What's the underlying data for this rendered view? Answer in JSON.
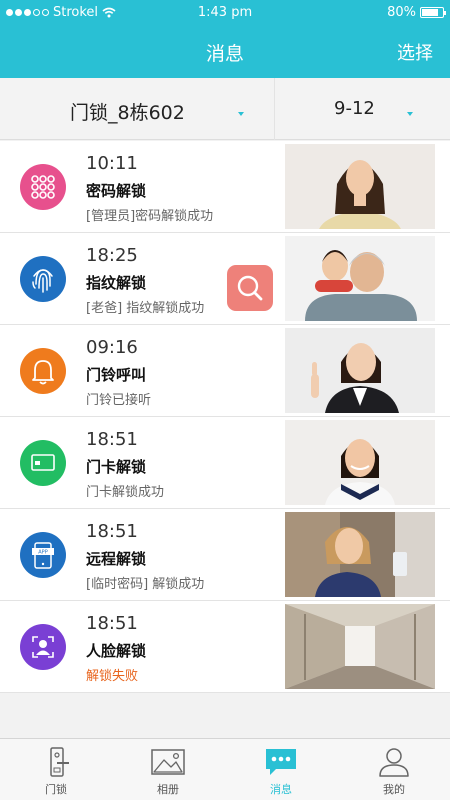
{
  "status_bar": {
    "carrier": "Strokel",
    "time": "1:43 pm",
    "battery": "80%",
    "battery_level": 0.8
  },
  "header": {
    "title": "消息",
    "action_label": "选择"
  },
  "filters": {
    "device": "门锁_8栋602",
    "date": "9-12"
  },
  "messages": [
    {
      "time": "10:11",
      "type": "密码解锁",
      "detail": "[管理员]密码解锁成功",
      "icon": "keypad-icon",
      "color": "#e7508d",
      "status": "success"
    },
    {
      "time": "18:25",
      "type": "指纹解锁",
      "detail": "[老爸] 指纹解锁成功",
      "icon": "fingerprint-icon",
      "color": "#1f70c1",
      "status": "success"
    },
    {
      "time": "09:16",
      "type": "门铃呼叫",
      "detail": "门铃已接听",
      "icon": "bell-icon",
      "color": "#ef7b1d",
      "status": "success"
    },
    {
      "time": "18:51",
      "type": "门卡解锁",
      "detail": "门卡解锁成功",
      "icon": "card-icon",
      "color": "#22bd63",
      "status": "success"
    },
    {
      "time": "18:51",
      "type": "远程解锁",
      "detail": "[临时密码] 解锁成功",
      "icon": "app-phone-icon",
      "color": "#1f70c1",
      "status": "success"
    },
    {
      "time": "18:51",
      "type": "人脸解锁",
      "detail": "解锁失败",
      "icon": "face-id-icon",
      "color": "#7a3fd4",
      "status": "fail"
    }
  ],
  "tabs": [
    {
      "label": "门锁",
      "icon": "door-lock-icon"
    },
    {
      "label": "相册",
      "icon": "album-icon"
    },
    {
      "label": "消息",
      "icon": "message-icon",
      "active": true
    },
    {
      "label": "我的",
      "icon": "profile-icon"
    }
  ],
  "colors": {
    "primary": "#29c0d4",
    "fail": "#e8651e",
    "search_button": "#ec7068"
  }
}
